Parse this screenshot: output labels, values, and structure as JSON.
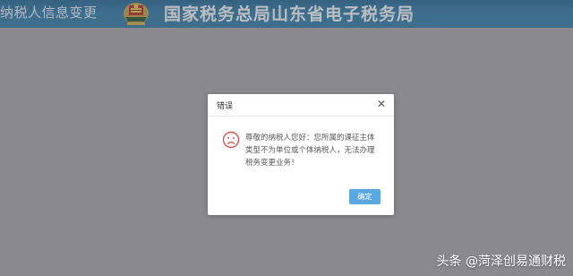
{
  "header": {
    "page_title": "纳税人信息变更",
    "site_title": "国家税务总局山东省电子税务局",
    "emblem_icon": "tax-emblem-icon"
  },
  "dialog": {
    "title": "错误",
    "close_icon": "close-icon",
    "status_icon": "sad-face-icon",
    "message": "尊敬的纳税人您好：您所属的课征主体类型不为单位或个体纳税人，无法办理税务变更业务！",
    "ok_label": "确定"
  },
  "watermark": {
    "text": "头条 @菏泽创易通财税"
  },
  "colors": {
    "overlay": "#8a8a8d",
    "header": "#3a7fa6",
    "button": "#5ba7e0",
    "sad_icon": "#e0504f"
  }
}
